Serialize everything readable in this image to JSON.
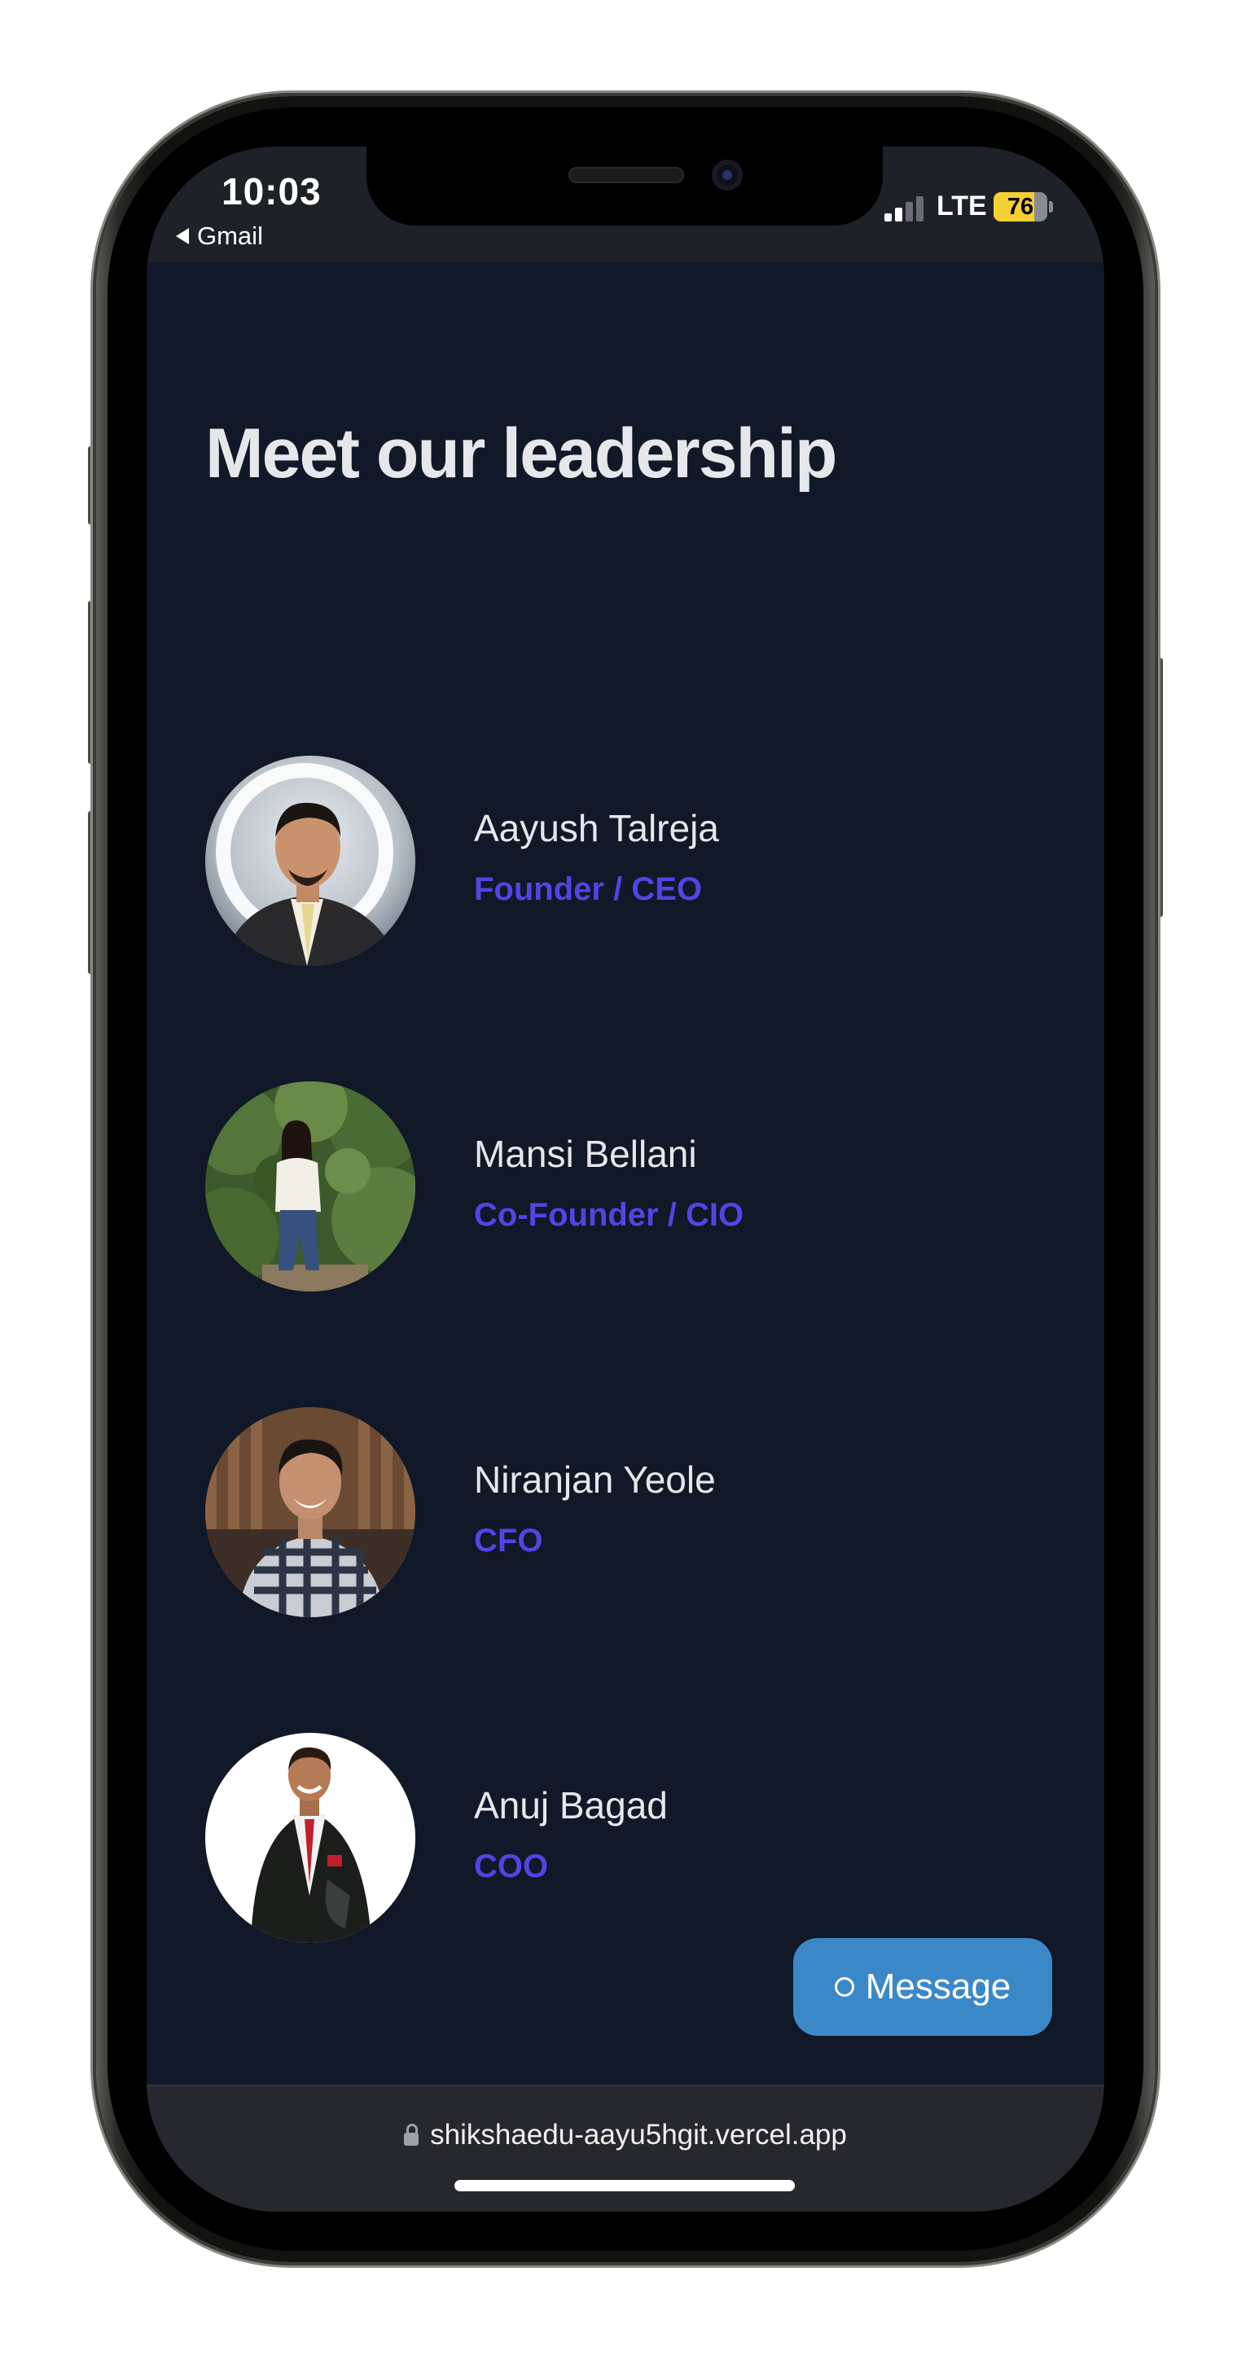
{
  "status_bar": {
    "time": "10:03",
    "back_app": "Gmail",
    "network": "LTE",
    "battery_percent": "76",
    "battery_level": 0.76,
    "signal_bars_active": 2,
    "signal_bars_total": 4
  },
  "page": {
    "heading": "Meet our leadership"
  },
  "leaders": [
    {
      "name": "Aayush Talreja",
      "role": "Founder / CEO"
    },
    {
      "name": "Mansi Bellani",
      "role": "Co-Founder / CIO"
    },
    {
      "name": "Niranjan Yeole",
      "role": "CFO"
    },
    {
      "name": "Anuj Bagad",
      "role": "COO"
    }
  ],
  "chat_widget": {
    "label": "Message",
    "icon": "chat-circle-icon",
    "color": "#3b88c9"
  },
  "browser": {
    "url": "shikshaedu-aayu5hgit.vercel.app",
    "icon": "lock-icon"
  },
  "colors": {
    "background": "#111827",
    "heading": "#e5e7eb",
    "role_accent": "#4f46e5"
  }
}
